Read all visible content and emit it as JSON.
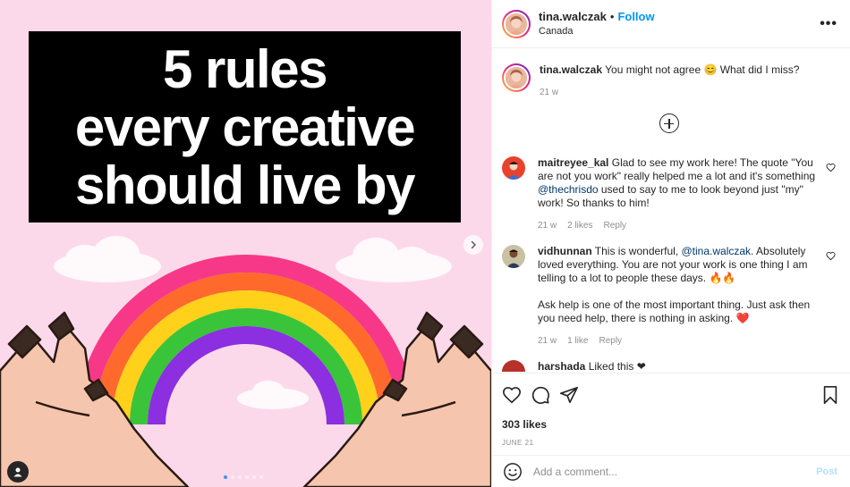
{
  "post": {
    "headline_lines": [
      "5 rules",
      "every creative",
      "should live by"
    ],
    "carousel_count": 6,
    "carousel_active": 0
  },
  "header": {
    "username": "tina.walczak",
    "separator": "•",
    "follow_label": "Follow",
    "location": "Canada",
    "more_label": "•••"
  },
  "caption": {
    "username": "tina.walczak",
    "text": "You might not agree 😊 What did I miss?",
    "time": "21 w"
  },
  "comments": [
    {
      "username": "maitreyee_kal",
      "text_before": "Glad to see my work here! The quote \"You are not you work\" really helped me a lot and it's something ",
      "mention": "@thechrisdo",
      "text_after": " used to say to me to look beyond just \"my\" work! So thanks to him!",
      "time": "21 w",
      "likes": "2 likes",
      "reply": "Reply",
      "avatar_color": "#e8412c"
    },
    {
      "username": "vidhunnan",
      "text_before": "This is wonderful, ",
      "mention": "@tina.walczak",
      "text_after": ". Absolutely loved everything. You are not your work is one thing I am telling to a lot to people these days. 🔥🔥",
      "text_para2": "Ask help is one of the most important thing. Just ask then you need help, there is nothing in asking. ❤️",
      "time": "21 w",
      "likes": "1 like",
      "reply": "Reply",
      "avatar_color": "#3d4a3a"
    },
    {
      "username": "harshada",
      "text_before": "Liked this ❤",
      "mention": "",
      "text_after": "",
      "avatar_color": "#b8302a"
    }
  ],
  "likes_count": "303 likes",
  "date": "JUNE 21",
  "add_comment": {
    "placeholder": "Add a comment...",
    "post_label": "Post"
  },
  "colors": {
    "accent": "#0095f6",
    "post_disabled": "#b2dffc",
    "background_pink": "#fcd9ea"
  }
}
